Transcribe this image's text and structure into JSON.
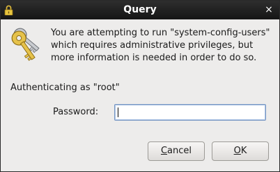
{
  "window": {
    "title": "Query",
    "close_label": "×"
  },
  "icons": {
    "title_icon": "lock-icon",
    "main_icon": "keys-icon"
  },
  "message": {
    "line1": "You are attempting to run \"system-config-users\"",
    "line2": "which requires administrative privileges, but",
    "line3": "more information is needed in order to do so."
  },
  "auth": {
    "label": "Authenticating as \"root\""
  },
  "password": {
    "label": "Password:",
    "value": ""
  },
  "buttons": {
    "cancel_mnemonic": "C",
    "cancel_rest": "ancel",
    "ok_mnemonic": "O",
    "ok_rest": "K"
  },
  "colors": {
    "titlebar": "#1f1f1f",
    "dialog_bg": "#edeceb",
    "input_focus": "#7a99c4"
  }
}
